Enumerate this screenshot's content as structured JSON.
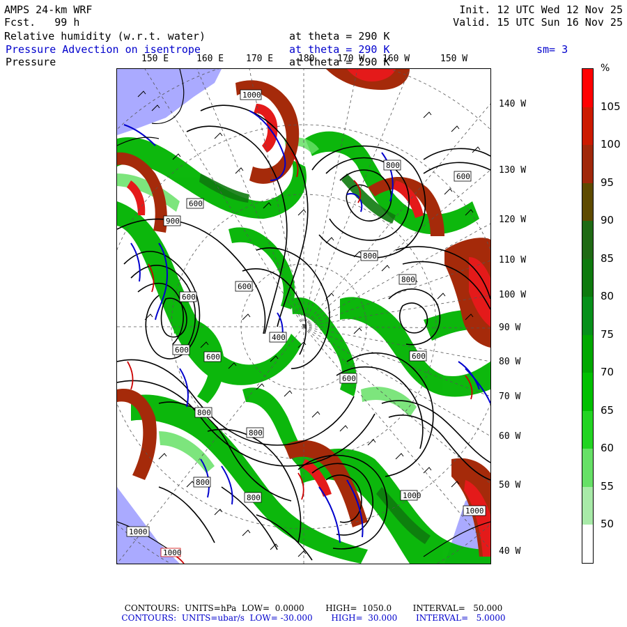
{
  "header": {
    "model": "AMPS 24-km WRF",
    "fcst": "Fcst.   99 h",
    "init": "Init. 12 UTC Wed 12 Nov 25",
    "valid": "Valid. 15 UTC Sun 16 Nov 25",
    "field1": "Relative humidity (w.r.t. water)",
    "field1_level": "at theta = 290 K",
    "field2": "Pressure Advection on isentrope",
    "field2_level": "at theta = 290 K",
    "smoothing": "sm= 3",
    "field3": "Pressure",
    "field3_level": "at theta = 290 K"
  },
  "map": {
    "lon_top_labels": [
      "150 E",
      "160 E",
      "170 E",
      "180",
      "170 W",
      "160 W",
      "150 W"
    ],
    "lat_right_labels": [
      "140 W",
      "130 W",
      "120 W",
      "110 W",
      "100 W",
      "90 W",
      "80 W",
      "70 W",
      "60 W",
      "50 W",
      "40 W"
    ],
    "contour_labels": [
      "1000",
      "800",
      "600",
      "900",
      "600",
      "800",
      "800",
      "600",
      "400",
      "600",
      "600",
      "600",
      "600",
      "800",
      "600",
      "800",
      "800",
      "800",
      "1000",
      "1000",
      "1000",
      "1000"
    ],
    "colors": {
      "ocean_land": "#aaaaff",
      "rh_red": "#e41a1a",
      "rh_brown": "#a52a0a",
      "rh_dark_green": "#006400",
      "rh_green": "#00b400",
      "adv_blue": "#0000cc",
      "adv_red": "#cc0000"
    }
  },
  "colorbar": {
    "unit": "%",
    "labels": [
      "105",
      "100",
      "95",
      "90",
      "85",
      "80",
      "75",
      "70",
      "65",
      "60",
      "55",
      "50"
    ],
    "colors": [
      "#ff0000",
      "#cc1a00",
      "#a0280a",
      "#5e4a00",
      "#1f6a14",
      "#0e7a0e",
      "#06901a",
      "#00a800",
      "#00c000",
      "#22d422",
      "#66e066",
      "#a8eaa8",
      "#ffffff"
    ]
  },
  "footer": {
    "line1": "CONTOURS:  UNITS=hPa  LOW=  0.0000        HIGH=  1050.0        INTERVAL=   50.000",
    "line2": "CONTOURS:  UNITS=ubar/s  LOW= -30.000       HIGH=  30.000       INTERVAL=   5.0000"
  }
}
